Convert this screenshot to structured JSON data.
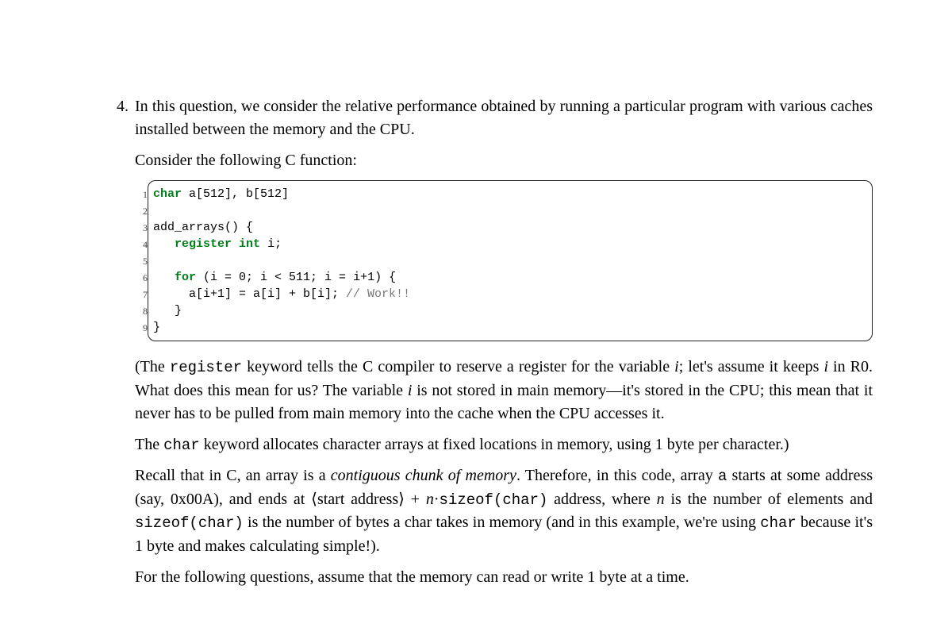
{
  "question_number": "4.",
  "intro_para": "In this question, we consider the relative performance obtained by running a particular program with various caches installed between the memory and the CPU.",
  "consider_para": "Consider the following C function:",
  "code": {
    "line_numbers": [
      "1",
      "2",
      "3",
      "4",
      "5",
      "6",
      "7",
      "8",
      "9"
    ],
    "kw_char": "char",
    "l1_rest": " a[512], b[512]",
    "l3": "add_arrays() {",
    "l4_pre": "   ",
    "kw_register": "register",
    "kw_int": "int",
    "l4_rest": " i;",
    "l6_pre": "   ",
    "kw_for": "for",
    "l6_rest": " (i = 0; i < 511; i = i+1) {",
    "l7_code": "     a[i+1] = a[i] + b[i]; ",
    "l7_comment": "// Work!!",
    "l8": "   }",
    "l9": "}"
  },
  "exp": {
    "p1_a": "(The ",
    "p1_kw_register": "register",
    "p1_b": " keyword tells the C compiler to reserve a register for the variable ",
    "p1_i1": "i",
    "p1_c": "; let's assume it keeps ",
    "p1_i2": "i",
    "p1_d": " in R0. What does this mean for us? The variable ",
    "p1_i3": "i",
    "p1_e": " is not stored in main memory—it's stored in the CPU; this mean that it never has to be pulled from main memory into the cache when the CPU accesses it.",
    "p2_a": "The ",
    "p2_kw_char": "char",
    "p2_b": " keyword allocates character arrays at fixed locations in memory, using 1 byte per character.)",
    "p3_a": "Recall that in C, an array is a ",
    "p3_em": "contiguous chunk of memory",
    "p3_b": ". Therefore, in this code, array ",
    "p3_tt_a": "a",
    "p3_c": " starts at some address (say, 0x00A), and ends at ⟨start address⟩ + ",
    "p3_n": "n",
    "p3_dot": "·",
    "p3_tt_sizeof1": "sizeof(char)",
    "p3_d": " address, where ",
    "p3_n2": "n",
    "p3_e": " is the number of elements and ",
    "p3_tt_sizeof2": "sizeof(char)",
    "p3_f": " is the number of bytes a char takes in memory (and in this example, we're using ",
    "p3_tt_char": "char",
    "p3_g": " because it's 1 byte and makes calculating simple!).",
    "p4": "For the following questions, assume that the memory can read or write 1 byte at a time."
  }
}
